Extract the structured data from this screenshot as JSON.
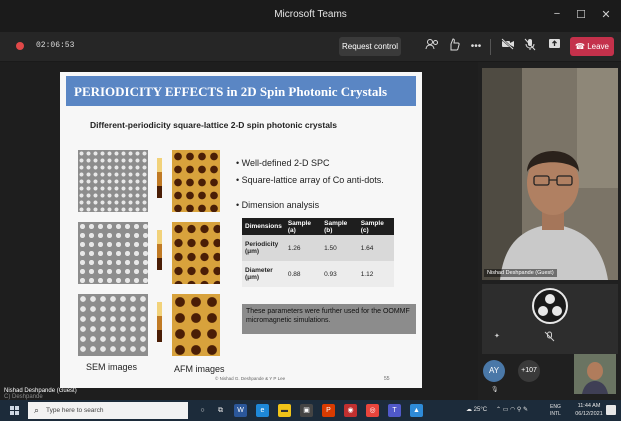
{
  "window": {
    "title": "Microsoft Teams",
    "minimize": "−",
    "maximize": "☐",
    "close": "✕"
  },
  "meeting": {
    "timer": "02:06:53",
    "request_control": "Request control",
    "leave": "Leave",
    "rec_color": "#e04848",
    "leave_color": "#c4314b"
  },
  "slide": {
    "title": "PERIODICITY EFFECTS in 2D Spin Photonic Crystals",
    "subtitle": "Different-periodicity square-lattice 2-D spin photonic crystals",
    "bullets": [
      "• Well-defined 2-D SPC",
      "• Square-lattice array of Co anti-dots.",
      "• Dimension analysis"
    ],
    "table": {
      "headers": [
        "Dimensions",
        "Sample (a)",
        "Sample (b)",
        "Sample (c)"
      ],
      "rows": [
        {
          "label": "Periodicity (μm)",
          "values": [
            "1.26",
            "1.50",
            "1.64"
          ]
        },
        {
          "label": "Diameter (μm)",
          "values": [
            "0.88",
            "0.93",
            "1.12"
          ]
        }
      ]
    },
    "note": "These parameters were further used for the OOMMF micromagnetic simulations.",
    "sem_caption": "SEM images",
    "afm_caption": "AFM images",
    "credit": "© Nishad G. Deshpande & Y P Lee",
    "page_number": "55",
    "header_color": "#5a86c4"
  },
  "stage": {
    "presenter_label": "Nishad Deshpande (Guest)",
    "watermark": "C) Deshpande"
  },
  "participants": {
    "video_label": "Nishad Deshpande (Guest)",
    "avatar_initials": "AY",
    "overflow_count": "+107"
  },
  "taskbar": {
    "search_placeholder": "Type here to search",
    "weather": "25°C",
    "lang": "ENG",
    "lang_sub": "INTL",
    "time": "11:44 AM",
    "date": "06/12/2021"
  }
}
